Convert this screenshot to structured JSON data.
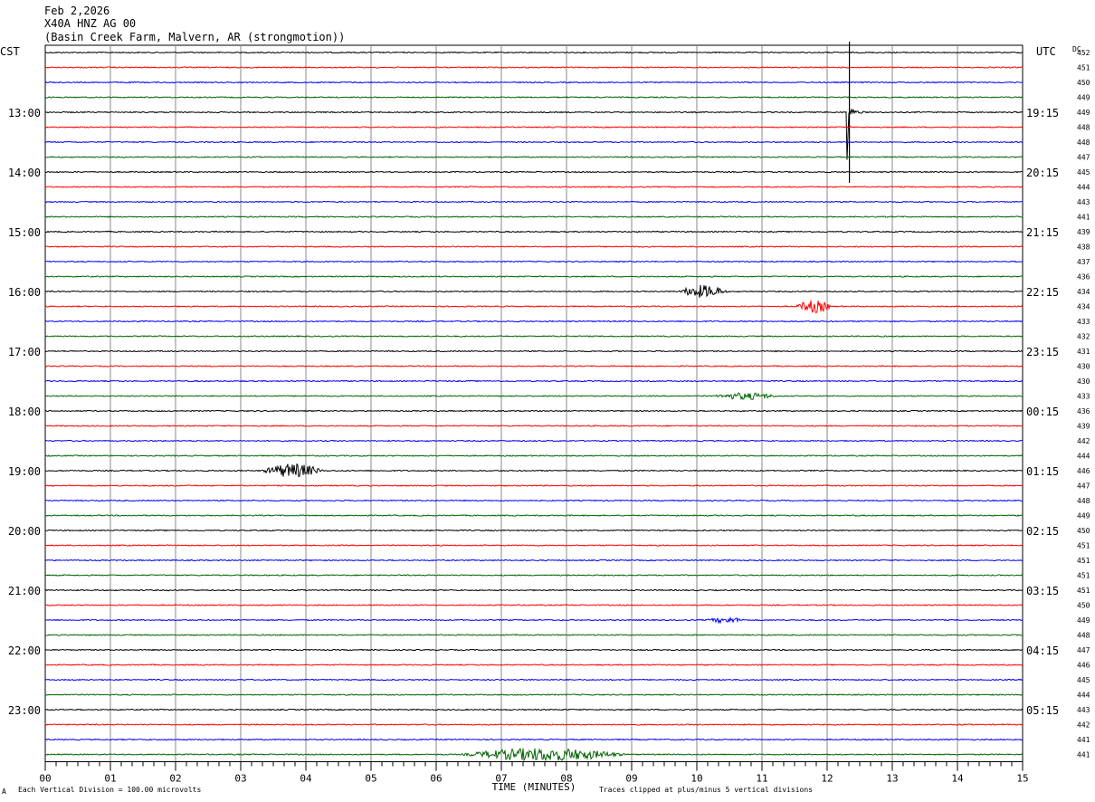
{
  "header": {
    "date": "Feb 2,2026",
    "station": "X40A HNZ AG 00",
    "location": "(Basin Creek Farm, Malvern, AR (strongmotion))"
  },
  "left_axis_title": "CST",
  "right_axis_title": "UTC",
  "dc_title": "DC",
  "footer": {
    "scale_note": "Each Vertical Division =  100.00 microvolts",
    "clip_note": "Traces clipped at plus/minus 5 vertical divisions",
    "corner_mark": "A"
  },
  "chart_data": {
    "type": "line",
    "title": "X40A HNZ AG 00",
    "xlabel": "TIME (MINUTES)",
    "xlim": [
      0,
      15
    ],
    "x_ticks": [
      "00",
      "01",
      "02",
      "03",
      "04",
      "05",
      "06",
      "07",
      "08",
      "09",
      "10",
      "11",
      "12",
      "13",
      "14",
      "15"
    ],
    "trace_count": 48,
    "trace_colors": [
      "#000000",
      "#ff0000",
      "#0000ff",
      "#006400"
    ],
    "left_labels": [
      {
        "trace": 4,
        "text": "13:00"
      },
      {
        "trace": 8,
        "text": "14:00"
      },
      {
        "trace": 12,
        "text": "15:00"
      },
      {
        "trace": 16,
        "text": "16:00"
      },
      {
        "trace": 20,
        "text": "17:00"
      },
      {
        "trace": 24,
        "text": "18:00"
      },
      {
        "trace": 28,
        "text": "19:00"
      },
      {
        "trace": 32,
        "text": "20:00"
      },
      {
        "trace": 36,
        "text": "21:00"
      },
      {
        "trace": 40,
        "text": "22:00"
      },
      {
        "trace": 44,
        "text": "23:00"
      }
    ],
    "right_labels": [
      {
        "trace": 4,
        "text": "19:15"
      },
      {
        "trace": 8,
        "text": "20:15"
      },
      {
        "trace": 12,
        "text": "21:15"
      },
      {
        "trace": 16,
        "text": "22:15"
      },
      {
        "trace": 20,
        "text": "23:15"
      },
      {
        "trace": 24,
        "text": "00:15"
      },
      {
        "trace": 28,
        "text": "01:15"
      },
      {
        "trace": 32,
        "text": "02:15"
      },
      {
        "trace": 36,
        "text": "03:15"
      },
      {
        "trace": 40,
        "text": "04:15"
      },
      {
        "trace": 44,
        "text": "05:15"
      }
    ],
    "dc_values": [
      "452",
      "451",
      "450",
      "449",
      "449",
      "448",
      "448",
      "447",
      "445",
      "444",
      "443",
      "441",
      "439",
      "438",
      "437",
      "436",
      "434",
      "434",
      "433",
      "432",
      "431",
      "430",
      "430",
      "433",
      "436",
      "439",
      "442",
      "444",
      "446",
      "447",
      "448",
      "449",
      "450",
      "451",
      "451",
      "451",
      "451",
      "450",
      "449",
      "448",
      "447",
      "446",
      "445",
      "444",
      "443",
      "442",
      "441",
      "441"
    ],
    "events": [
      {
        "trace": 4,
        "start_min": 12.3,
        "end_min": 12.9,
        "peak": 12,
        "type": "spike"
      },
      {
        "trace": 16,
        "start_min": 9.7,
        "end_min": 10.5,
        "peak": 0.45,
        "type": "burst"
      },
      {
        "trace": 17,
        "start_min": 11.5,
        "end_min": 12.1,
        "peak": 0.45,
        "type": "burst"
      },
      {
        "trace": 23,
        "start_min": 10.2,
        "end_min": 11.3,
        "peak": 0.25,
        "type": "burst"
      },
      {
        "trace": 28,
        "start_min": 3.3,
        "end_min": 4.3,
        "peak": 0.5,
        "type": "burst"
      },
      {
        "trace": 38,
        "start_min": 10.1,
        "end_min": 10.8,
        "peak": 0.2,
        "type": "burst"
      },
      {
        "trace": 47,
        "start_min": 6.3,
        "end_min": 9.0,
        "peak": 0.45,
        "type": "burst"
      }
    ]
  }
}
